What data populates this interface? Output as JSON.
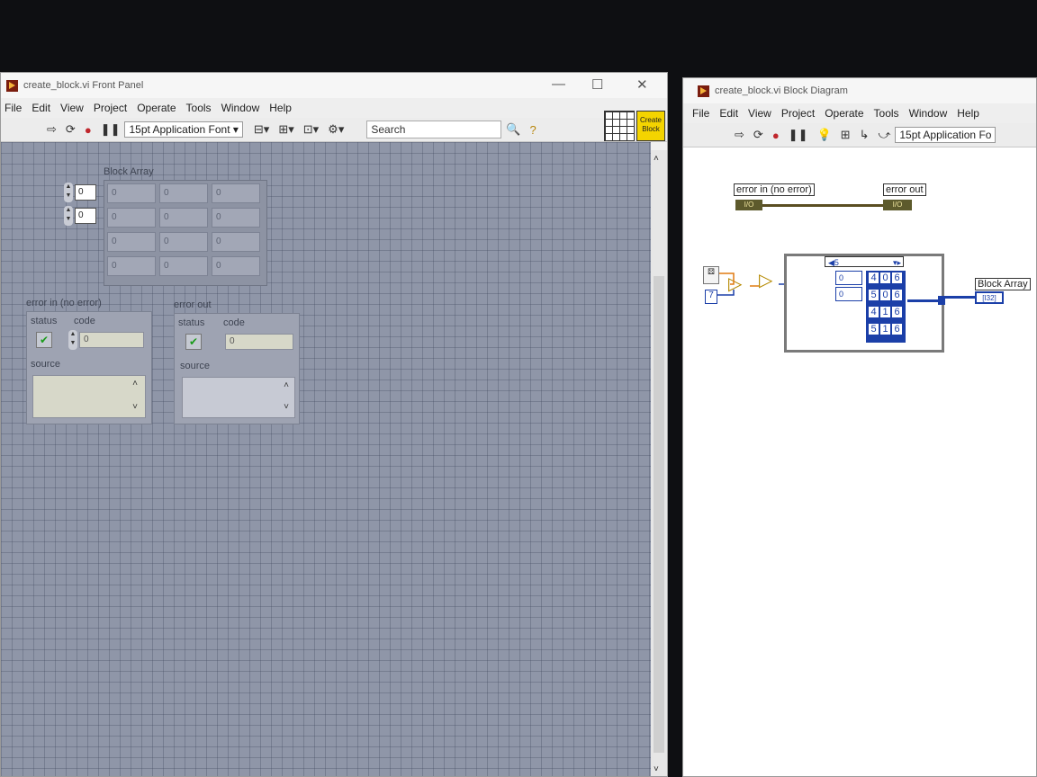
{
  "front_panel": {
    "title": "create_block.vi Front Panel",
    "controls": {
      "minimize": "—",
      "maximize": "☐",
      "close": "✕"
    },
    "menu": [
      "File",
      "Edit",
      "View",
      "Project",
      "Operate",
      "Tools",
      "Window",
      "Help"
    ],
    "toolbar": {
      "font": "15pt Application Font",
      "search_placeholder": "Search",
      "vi_icon_text": [
        "Create",
        "Block"
      ]
    },
    "block_array": {
      "label": "Block Array",
      "indices": [
        "0",
        "0"
      ],
      "rows": [
        [
          "0",
          "0",
          "0"
        ],
        [
          "0",
          "0",
          "0"
        ],
        [
          "0",
          "0",
          "0"
        ],
        [
          "0",
          "0",
          "0"
        ]
      ]
    },
    "error_in": {
      "label": "error in (no error)",
      "status_label": "status",
      "code_label": "code",
      "code_value": "0",
      "source_label": "source",
      "source_value": ""
    },
    "error_out": {
      "label": "error out",
      "status_label": "status",
      "code_label": "code",
      "code_value": "0",
      "source_label": "source",
      "source_value": ""
    }
  },
  "block_diagram": {
    "title": "create_block.vi Block Diagram",
    "menu": [
      "File",
      "Edit",
      "View",
      "Project",
      "Operate",
      "Tools",
      "Window",
      "Help"
    ],
    "toolbar": {
      "font": "15pt Application Fo"
    },
    "terminals": {
      "error_in": "error in (no error)",
      "error_out": "error out",
      "block_array": "Block Array",
      "error_in_type": "I/O",
      "error_out_type": "I/O",
      "block_array_type": "[I32]"
    },
    "constant": "7",
    "loop_count": "5",
    "inner_array": {
      "indices": [
        "0",
        "0"
      ],
      "rows": [
        [
          "4",
          "0",
          "6"
        ],
        [
          "5",
          "0",
          "6"
        ],
        [
          "4",
          "1",
          "6"
        ],
        [
          "5",
          "1",
          "6"
        ]
      ]
    }
  }
}
